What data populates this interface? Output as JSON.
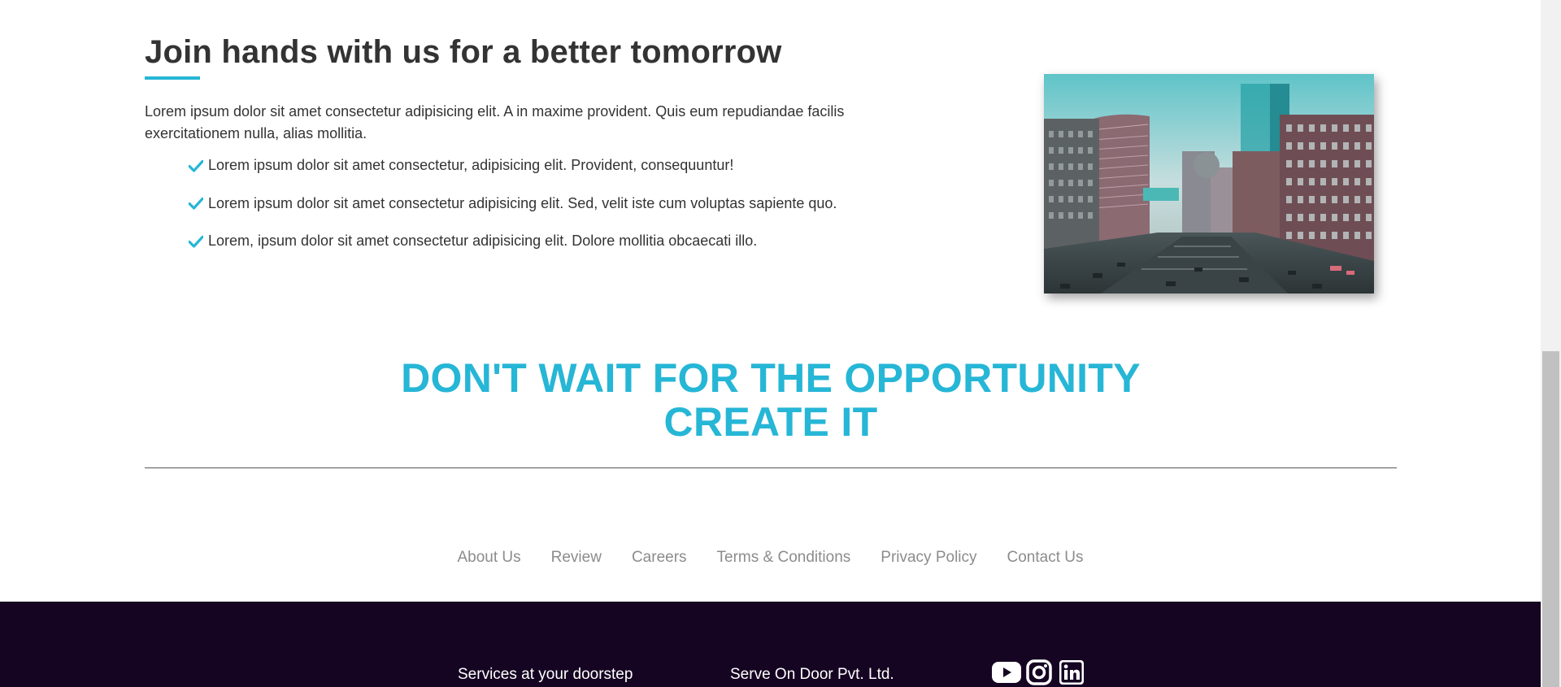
{
  "join": {
    "title": "Join hands with us for a better tomorrow",
    "intro": "Lorem ipsum dolor sit amet consectetur adipisicing elit. A in maxime provident. Quis eum repudiandae facilis exercitationem nulla, alias mollitia.",
    "checklist": [
      "Lorem ipsum dolor sit amet consectetur, adipisicing elit. Provident, consequuntur!",
      "Lorem ipsum dolor sit amet consectetur adipisicing elit. Sed, velit iste cum voluptas sapiente quo.",
      "Lorem, ipsum dolor sit amet consectetur adipisicing elit. Dolore mollitia obcaecati illo."
    ],
    "check_icon": "check-icon",
    "image_icon": "city-buildings-photo"
  },
  "slogan": {
    "line1": "DON'T WAIT FOR THE OPPORTUNITY",
    "line2": "CREATE IT"
  },
  "footer_nav": [
    "About Us",
    "Review",
    "Careers",
    "Terms & Conditions",
    "Privacy Policy",
    "Contact Us"
  ],
  "bottom_footer": {
    "tagline": "Services at your doorstep",
    "company": "Serve On Door Pvt. Ltd.",
    "social": [
      "youtube-icon",
      "instagram-icon",
      "linkedin-icon"
    ]
  },
  "colors": {
    "accent": "#26b6d6",
    "footer_bg": "#150522",
    "text": "#333333",
    "nav_text": "#8c8c8c"
  }
}
